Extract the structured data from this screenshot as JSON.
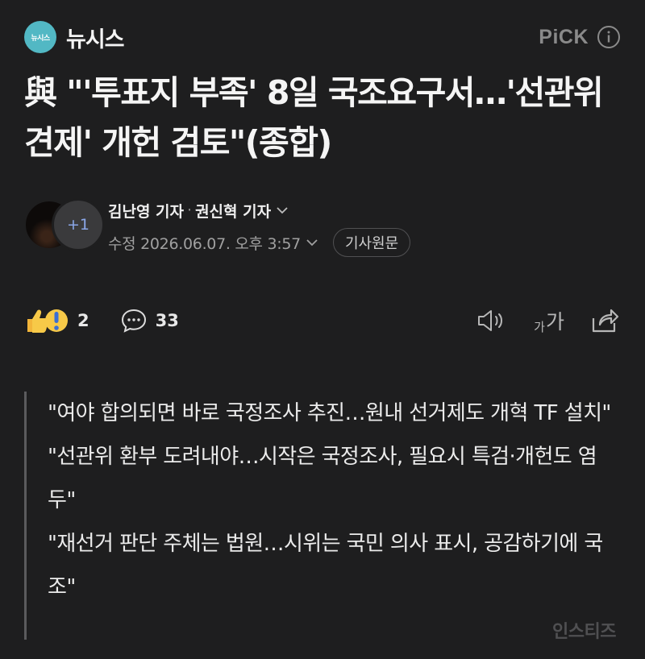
{
  "header": {
    "brand_logo_text": "뉴시스",
    "brand_name": "뉴시스",
    "pick_label": "PiCK"
  },
  "article": {
    "title": "與 \"'투표지 부족' 8일 국조요구서…'선관위 견제' 개헌 검토\"(종합)",
    "reporters": [
      "김난영 기자",
      "권신혁 기자"
    ],
    "reporter_separator": "·",
    "more_reporters": "+1",
    "date": "수정 2026.06.07. 오후 3:57",
    "source_button": "기사원문"
  },
  "actions": {
    "reaction_count": "2",
    "comment_count": "33",
    "font_small": "가",
    "font_large": "가"
  },
  "summary": [
    "\"여야 합의되면 바로 국정조사 추진…원내 선거제도 개혁 TF 설치\"",
    "\"선관위 환부 도려내야…시작은 국정조사, 필요시 특검·개헌도 염두\"",
    "\"재선거 판단 주체는 법원…시위는 국민 의사 표시, 공감하기에 국조\""
  ],
  "watermark": "인스티즈",
  "colors": {
    "background": "#1e1e1f",
    "brand": "#52b8c4",
    "more_reporters": "#8aa6e8"
  }
}
